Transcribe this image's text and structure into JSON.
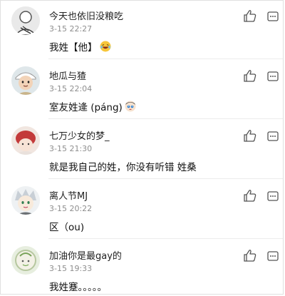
{
  "comments": [
    {
      "name": "今天也依旧没粮吃",
      "time": "3-15 22:27",
      "text": "我姓【他】",
      "emoji": "laughing-face-emoji"
    },
    {
      "name": "地瓜与猹",
      "time": "3-15 22:04",
      "text": "室友姓逄 (páng)",
      "emoji": "anime-face-emoji"
    },
    {
      "name": "七万少女的梦_",
      "time": "3-15 21:30",
      "text": "就是我自己的姓，你没有听错 姓桑",
      "emoji": ""
    },
    {
      "name": "离人节MJ",
      "time": "3-15 20:22",
      "text": "区（ou)",
      "emoji": ""
    },
    {
      "name": "加油你是最gay的",
      "time": "3-15 19:33",
      "text": "我姓蹇。。。。。",
      "emoji": ""
    }
  ],
  "icons": {
    "like": "thumbs-up-icon",
    "more": "more-options-icon"
  },
  "colors": {
    "name": "#222222",
    "time": "#8e8e8e",
    "divider": "#ececec"
  }
}
